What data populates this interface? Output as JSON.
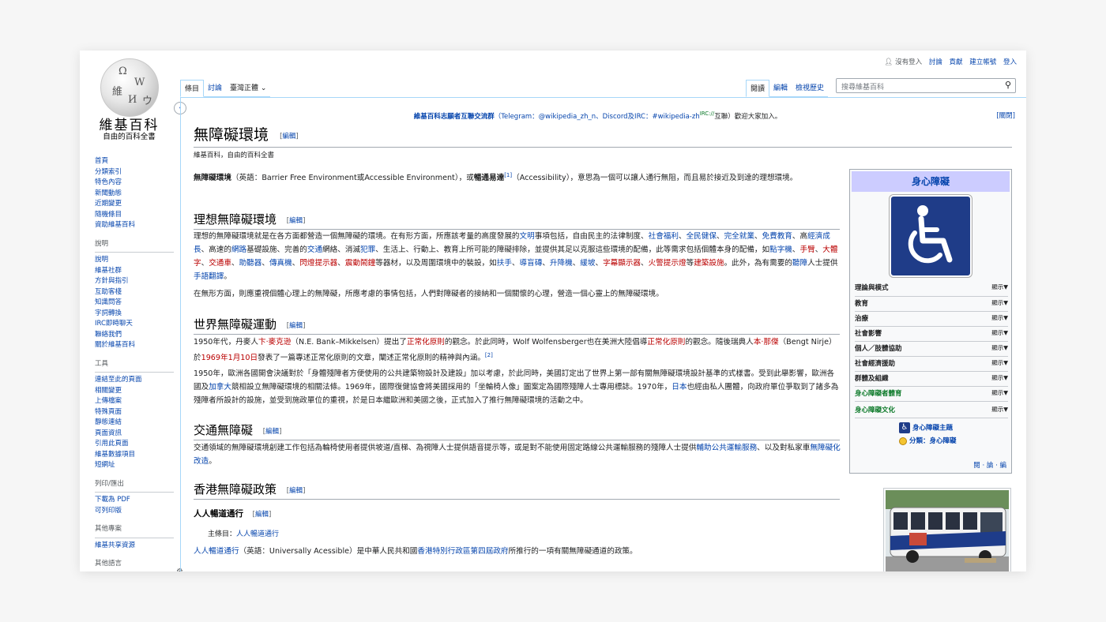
{
  "personal_tools": {
    "not_logged_in": "沒有登入",
    "talk": "討論",
    "contributions": "貢獻",
    "create_account": "建立帳號",
    "login": "登入"
  },
  "logo": {
    "title": "維基百科",
    "subtitle": "自由的百科全書",
    "globe_glyphs": [
      "Ω",
      "W",
      "維",
      "И",
      "ウ"
    ]
  },
  "tabs": {
    "article": "條目",
    "talk": "討論",
    "variant": "臺灣正體",
    "read": "閱讀",
    "edit": "編輯",
    "history": "檢視歷史"
  },
  "search": {
    "placeholder": "搜尋維基百科"
  },
  "sidebar": {
    "main_items": [
      "首頁",
      "分類索引",
      "特色內容",
      "新聞動態",
      "近期變更",
      "隨機條目",
      "資助維基百科"
    ],
    "help_head": "說明",
    "help_items": [
      "說明",
      "維基社群",
      "方針與指引",
      "互助客棧",
      "知識問答",
      "字詞轉換",
      "IRC即時聊天",
      "聯絡我們",
      "關於維基百科"
    ],
    "tools_head": "工具",
    "tools_items": [
      "連結至此的頁面",
      "相關變更",
      "上傳檔案",
      "特殊頁面",
      "靜態連結",
      "頁面資訊",
      "引用此頁面",
      "維基數據項目",
      "短網址"
    ],
    "print_head": "列印/匯出",
    "print_items": [
      "下載為 PDF",
      "可列印版"
    ],
    "projects_head": "其他專案",
    "projects_items": [
      "維基共享資源"
    ],
    "languages_head": "其他語言"
  },
  "sitenotice": {
    "text_bold": "維基百科志願者互聯交流群",
    "text_rest": "（Telegram：@wikipedia_zh_n、Discord及IRC：#wikipedia-zh",
    "irc_sup": "IRC://",
    "text_tail": "互聯）歡迎大家加入。",
    "dismiss": "[關閉]"
  },
  "article": {
    "title": "無障礙環境",
    "edit_open": "[",
    "edit_label": "編輯",
    "edit_close": "]",
    "tagline": "維基百科，自由的百科全書",
    "intro_b1": "無障礙環境",
    "intro_t1": "（英語：Barrier Free Environment或Accessible Environment），或",
    "intro_b2": "暢通易達",
    "intro_sup": "[1]",
    "intro_t2": "（Accessibility），意思為一個可以讓人通行無阻，而且易於接近及到達的理想環境。",
    "sec1_title": "理想無障礙環境",
    "sec1_p1_a": "理想的無障礙環境就是在各方面都營造一個無障礙的環境。在有形方面，所應該考量的高度發展的",
    "sec1_p1_l1": "文明",
    "sec1_p1_b": "事項包括，自由民主的法律制度、",
    "sec1_p1_l2": "社會福利",
    "sec1_p1_c": "、",
    "sec1_p1_l3": "全民健保",
    "sec1_p1_d": "、",
    "sec1_p1_l4": "完全就業",
    "sec1_p1_e": "、",
    "sec1_p1_l5": "免費教育",
    "sec1_p1_f": "、高",
    "sec1_p1_l6": "經濟成長",
    "sec1_p1_g": "、高速的",
    "sec1_p1_l7": "網路",
    "sec1_p1_h": "基礎設施、完善的",
    "sec1_p1_l8": "交通",
    "sec1_p1_i": "網絡、消滅",
    "sec1_p1_l9": "犯罪",
    "sec1_p1_j": "、生活上、行動上、教育上所可能的障礙排除，並提供其足以克服這些環境的配備，此等需求包括個體本身的配備，如",
    "sec1_p1_l10": "點字機",
    "sec1_p1_k": "、",
    "sec1_p1_r1": "手臂",
    "sec1_p1_m": "、",
    "sec1_p1_r2": "大體字",
    "sec1_p1_n": "、",
    "sec1_p1_r3": "交通車",
    "sec1_p1_o": "、",
    "sec1_p1_r4": "助聽器",
    "sec1_p1_p": "、",
    "sec1_p1_r5": "傳真機",
    "sec1_p1_q": "、",
    "sec1_p1_r6": "閃燈提示器",
    "sec1_p1_s": "、",
    "sec1_p1_r7": "震動鬧鐘",
    "sec1_p1_t": "等器材，以及周圍環境中的裝設，如",
    "sec1_p1_l11": "扶手",
    "sec1_p1_u": "、",
    "sec1_p1_l12": "導盲磚",
    "sec1_p1_v": "、",
    "sec1_p1_l13": "升降機",
    "sec1_p1_w": "、",
    "sec1_p1_l14": "緩坡",
    "sec1_p1_x": "、",
    "sec1_p1_r8": "字幕顯示器",
    "sec1_p1_y": "、",
    "sec1_p1_r9": "火警提示燈",
    "sec1_p1_z": "等",
    "sec1_p1_r10": "建築設施",
    "sec1_p1_z2": "。此外，為有需要的",
    "sec1_p1_l15": "聽障",
    "sec1_p1_z3": "人士提供",
    "sec1_p1_l16": "手語翻譯",
    "sec1_p1_z4": "。",
    "sec1_p2": "在無形方面，則應重視個體心理上的無障礙，所應考慮的事情包括，人們對障礙者的接納和一個關懷的心理，營造一個心靈上的無障礙環境。",
    "sec2_title": "世界無障礙運動",
    "sec2_p1_a": "1950年代，丹麥人",
    "sec2_p1_r1": "卞·麥克逊",
    "sec2_p1_b": "（N.E. Bank–Mikkelsen）提出了",
    "sec2_p1_r2": "正常化原則",
    "sec2_p1_c": "的觀念。於此同時，Wolf Wolfensberger也在美洲大陸倡導",
    "sec2_p1_r3": "正常化原則",
    "sec2_p1_d": "的觀念。隨後瑞典人",
    "sec2_p1_r4": "本·那傑",
    "sec2_p1_e": "（Bengt Nirje）於",
    "sec2_p1_r5": "1969年1月10日",
    "sec2_p1_f": "發表了一篇專述正常化原則的文章，闡述正常化原則的精神與內涵。",
    "sec2_p1_sup": "[2]",
    "sec2_p2_a": "1950年，歐洲各國開會決議對於「身體殘障者方便使用的公共建築物設計及建設」加以考慮，於此同時，美國訂定出了世界上第一部有關無障礙環境設計基準的式樣書。受到此舉影響，歐洲各國及",
    "sec2_p2_l1": "加拿大",
    "sec2_p2_b": "競相設立無障礙環境的相關法條。1969年，國際復健協會將美國採用的「坐輪椅人像」圖案定為國際殘障人士專用標誌。1970年，",
    "sec2_p2_l2": "日本",
    "sec2_p2_c": "也經由私人團體，向政府單位爭取到了諸多為殘障者所設計的設施，並受到施政單位的重視，於是日本繼歐洲和美國之後，正式加入了推行無障礙環境的活動之中。",
    "sec3_title": "交通無障礙",
    "sec3_p_a": "交通領域的無障礙環境創建工作包括為輪椅使用者提供坡道/直梯、為視障人士提供語音提示等，或是對不能使用固定路線公共運輸服務的殘障人士提供",
    "sec3_p_l1": "輔助公共運輸服務",
    "sec3_p_b": "、以及對私家車",
    "sec3_p_l2": "無障礙化改造",
    "sec3_p_c": "。",
    "sec4_title": "香港無障礙政策",
    "sec4_h3": "人人暢道通行",
    "sec4_hatnote_a": "主條目：",
    "sec4_hatnote_l": "人人暢道通行",
    "sec4_p_l1": "人人暢道通行",
    "sec4_p_a": "（英語：Universally Acessible）是中華人民共和國",
    "sec4_p_l2": "香港特別行政區第四屆政府",
    "sec4_p_b": "所推行的一項有關無障礙通道的政策。"
  },
  "infobox": {
    "title": "身心障礙",
    "rows": [
      "理論與模式",
      "教育",
      "治療",
      "社會影響",
      "個人／肢體協助",
      "社會經濟援助",
      "群體及組織",
      "身心障礙者體育",
      "身心障礙文化"
    ],
    "show": "顯示▼",
    "portal": "身心障礙主題",
    "category": "分類：身心障礙",
    "vte": "閱 · 論 · 編"
  },
  "colors": {
    "link": "#0645ad",
    "redlink": "#ba0000",
    "infobox_title_bg": "#ccccff",
    "wheelchair_bg": "#1f3c88"
  }
}
